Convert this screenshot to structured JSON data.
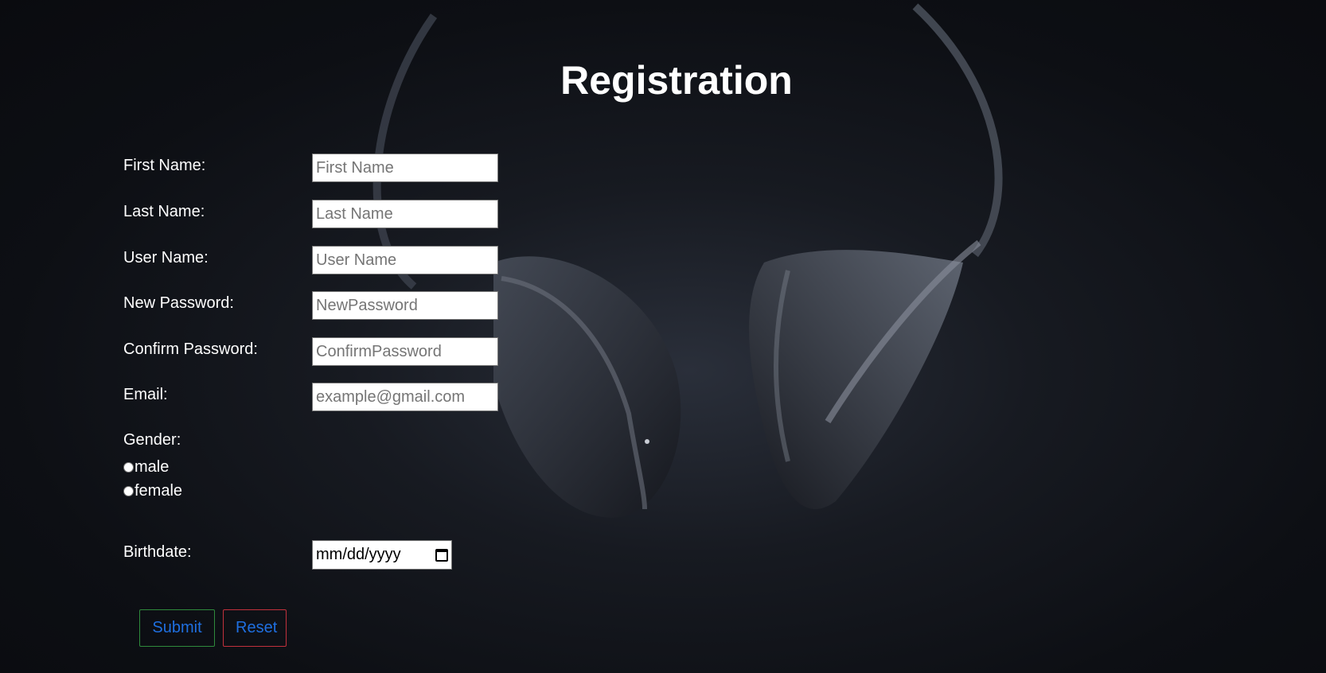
{
  "page": {
    "title": "Registration"
  },
  "form": {
    "fields": [
      {
        "label": "First Name:",
        "placeholder": "First Name",
        "value": ""
      },
      {
        "label": "Last Name:",
        "placeholder": "Last Name",
        "value": ""
      },
      {
        "label": "User Name:",
        "placeholder": "User Name",
        "value": ""
      },
      {
        "label": "New Password:",
        "placeholder": "NewPassword",
        "value": ""
      },
      {
        "label": "Confirm Password:",
        "placeholder": "ConfirmPassword",
        "value": ""
      },
      {
        "label": "Email:",
        "placeholder": "example@gmail.com",
        "value": ""
      }
    ],
    "gender": {
      "label": "Gender:",
      "options": [
        "male",
        "female"
      ],
      "selected": null
    },
    "birthdate": {
      "label": "Birthdate:",
      "placeholder": "mm/dd/yyyy",
      "icon": "calendar-icon"
    },
    "buttons": {
      "submit_label": "Submit",
      "reset_label": "Reset"
    }
  },
  "colors": {
    "background": "#0d0f14",
    "text": "#ffffff",
    "button_text": "#1f6fe0",
    "submit_border": "#2f8a3c",
    "reset_border": "#c2313c"
  }
}
